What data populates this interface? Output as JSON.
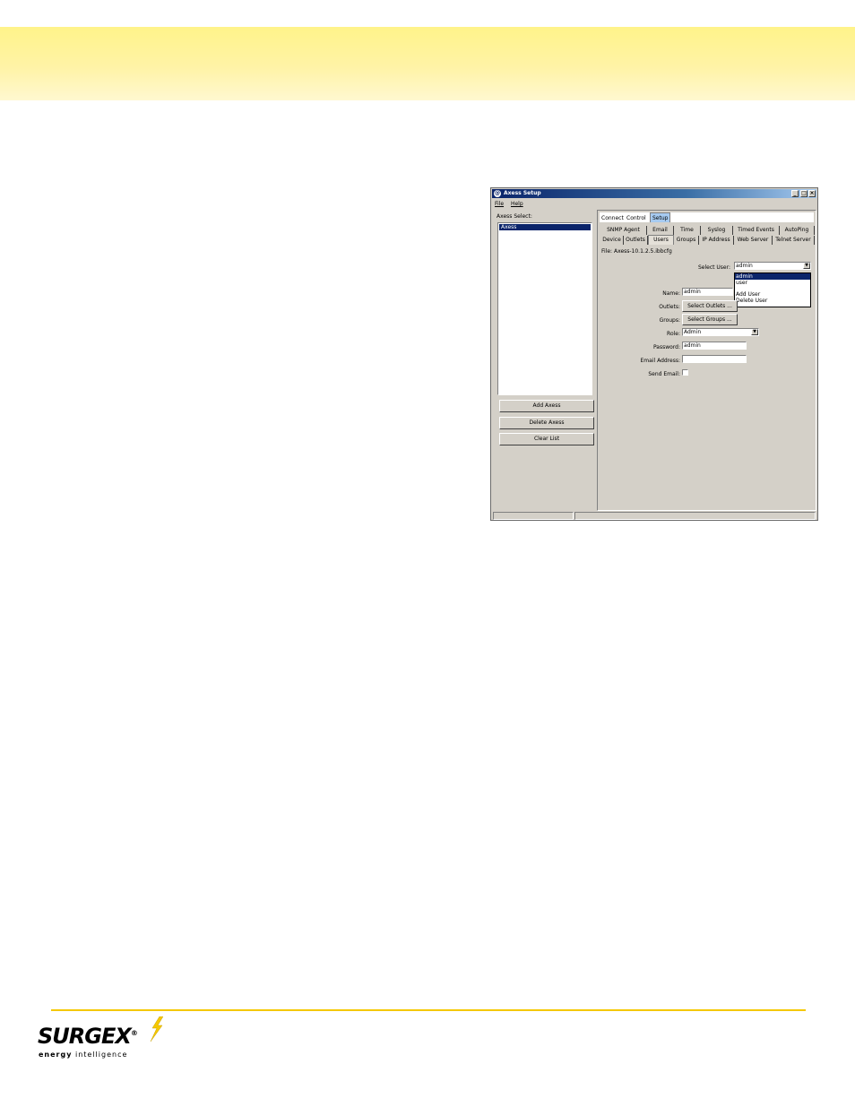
{
  "window": {
    "title": "Axess Setup",
    "menu": {
      "file": "File",
      "help": "Help"
    },
    "axess_select_label": "Axess Select:",
    "list_items": [
      "Axess"
    ],
    "buttons": {
      "add": "Add Axess",
      "delete": "Delete Axess",
      "clear": "Clear List"
    },
    "top_tabs": [
      "Connect",
      "Control",
      "Setup"
    ],
    "tabs_row1": [
      "SNMP Agent",
      "Email",
      "Time",
      "Syslog",
      "Timed Events",
      "AutoPing"
    ],
    "tabs_row2": [
      "Device",
      "Outlets",
      "Users",
      "Groups",
      "IP Address",
      "Web Server",
      "Telnet Server"
    ],
    "active_tab": "Users",
    "file_text": "File: Axess-10.1.2.5.ibbcfg",
    "form": {
      "select_user_label": "Select User:",
      "select_user_value": "admin",
      "dropdown_options": [
        "admin",
        "user",
        "Add User",
        "Delete User"
      ],
      "name_label": "Name:",
      "name_value": "admin",
      "outlets_label": "Outlets:",
      "outlets_button": "Select Outlets ...",
      "groups_label": "Groups:",
      "groups_button": "Select Groups ...",
      "role_label": "Role:",
      "role_value": "Admin",
      "password_label": "Password:",
      "password_value": "admin",
      "email_label": "Email Address:",
      "email_value": "",
      "send_email_label": "Send Email:"
    }
  },
  "logo": {
    "brand": "SURGEX",
    "registered": "®",
    "tagline_bold": "energy",
    "tagline_rest": "intelligence"
  },
  "colors": {
    "band": "#fff38a",
    "footer_line": "#f5c800",
    "titlebar": "#0a246a",
    "selection": "#0a246a"
  }
}
